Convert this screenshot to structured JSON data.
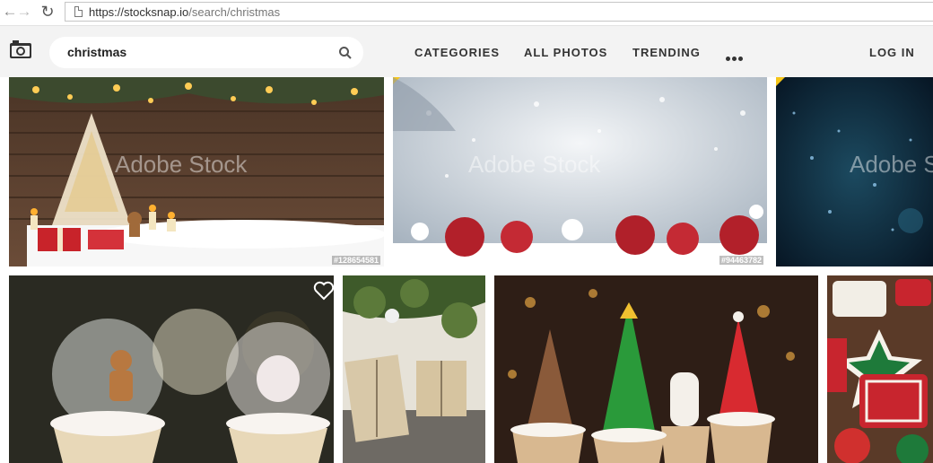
{
  "browser": {
    "url_host": "https://stocksnap.io",
    "url_path": "/search/christmas",
    "back_icon": "arrow-left-icon",
    "forward_icon": "arrow-right-icon",
    "reload_icon": "reload-icon",
    "page_icon": "page-icon"
  },
  "header": {
    "logo_icon": "camera-icon",
    "search": {
      "value": "christmas",
      "icon": "search-icon"
    },
    "nav": [
      "CATEGORIES",
      "ALL PHOTOS",
      "TRENDING"
    ],
    "more_icon": "more-dots-icon",
    "login": "LOG IN",
    "background": "#f3f3f3"
  },
  "grid": {
    "row1": [
      {
        "subject": "wooden christmas tree with candles",
        "watermark": "Adobe Stock",
        "id": "#128654581",
        "badge_color": "#f5c518"
      },
      {
        "subject": "red christmas baubles on snow",
        "watermark": "Adobe Stock",
        "id": "#94463782",
        "badge_color": "#f5c518"
      },
      {
        "subject": "blue bokeh background",
        "watermark": "Adobe Stock"
      }
    ],
    "row2": [
      {
        "subject": "snow globe gingerbread cupcakes",
        "heart_icon": "heart-icon"
      },
      {
        "subject": "wrapped gifts with fir branches"
      },
      {
        "subject": "christmas tree cupcakes"
      },
      {
        "subject": "decorated christmas cookies"
      }
    ]
  }
}
